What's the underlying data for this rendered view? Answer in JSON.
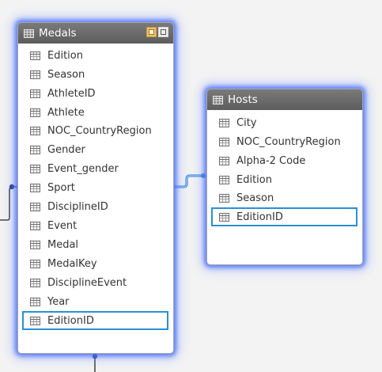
{
  "medals_table": {
    "title": "Medals",
    "fields": [
      "Edition",
      "Season",
      "AthleteID",
      "Athlete",
      "NOC_CountryRegion",
      "Gender",
      "Event_gender",
      "Sport",
      "DisciplineID",
      "Event",
      "Medal",
      "MedalKey",
      "DisciplineEvent",
      "Year",
      "EditionID"
    ],
    "selected_field": "EditionID"
  },
  "hosts_table": {
    "title": "Hosts",
    "fields": [
      "City",
      "NOC_CountryRegion",
      "Alpha-2 Code",
      "Edition",
      "Season",
      "EditionID"
    ],
    "selected_field": "EditionID"
  },
  "colors": {
    "glow": "#4a72ff",
    "selection": "#2b8fd6",
    "header": "#6a6a6a",
    "connector": "#1f5fb0"
  }
}
